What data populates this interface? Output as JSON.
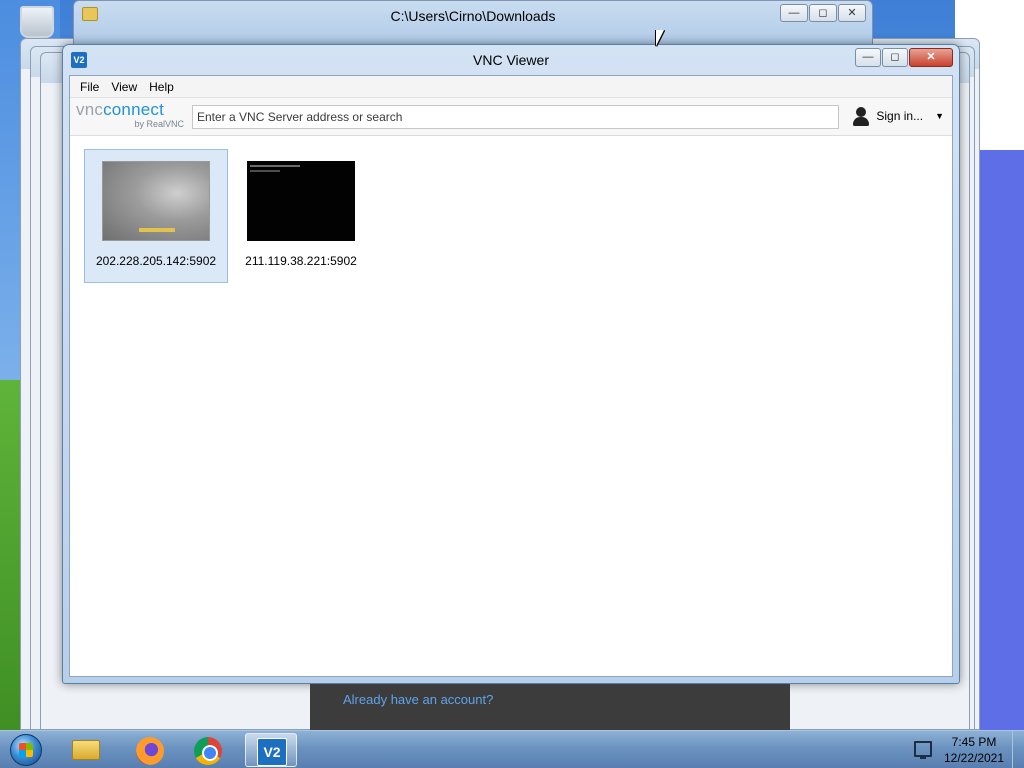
{
  "explorer_window": {
    "title": "C:\\Users\\Cirno\\Downloads",
    "controls": {
      "minimize": "—",
      "maximize": "◻",
      "close": "✕"
    }
  },
  "vnc_window": {
    "title": "VNC Viewer",
    "app_icon_text": "V2",
    "controls": {
      "minimize": "—",
      "maximize": "◻",
      "close": "✕"
    },
    "menu": [
      "File",
      "View",
      "Help"
    ],
    "brand": {
      "vnc": "vnc",
      "connect": "connect",
      "sub": "by RealVNC"
    },
    "search": {
      "placeholder": "Enter a VNC Server address or search",
      "value": ""
    },
    "sign_in": {
      "label": "Sign in...",
      "caret": "▼"
    },
    "connections": [
      {
        "label": "202.228.205.142:5902",
        "thumbnail": "desktop-preview",
        "selected": true
      },
      {
        "label": "211.119.38.221:5902",
        "thumbnail": "black-console",
        "selected": false
      }
    ]
  },
  "account_popup": {
    "link": "Already have an account?"
  },
  "taskbar": {
    "buttons": [
      "windows-explorer",
      "firefox",
      "chrome",
      "vnc-viewer"
    ],
    "active": "vnc-viewer",
    "vnc_icon_text": "V2",
    "clock": {
      "time": "7:45 PM",
      "date": "12/22/2021"
    }
  }
}
